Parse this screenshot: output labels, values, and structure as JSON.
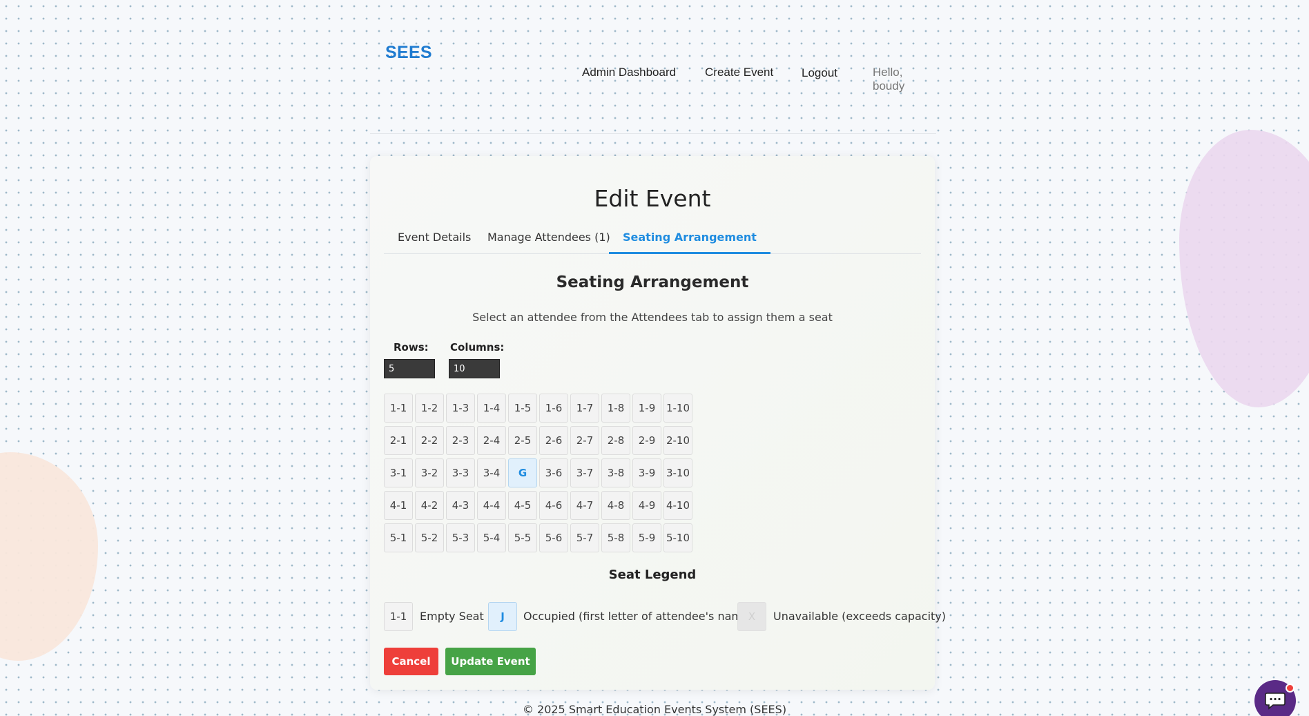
{
  "header": {
    "logo": "SEES",
    "nav": {
      "admin_dashboard": "Admin Dashboard",
      "create_event": "Create Event",
      "logout": "Logout"
    },
    "greeting": "Hello, boudy"
  },
  "card": {
    "title": "Edit Event",
    "tabs": {
      "details": "Event Details",
      "attendees": "Manage Attendees (1)",
      "seating": "Seating Arrangement"
    },
    "active_tab": "Seating Arrangement"
  },
  "seating": {
    "title": "Seating Arrangement",
    "instruction": "Select an attendee from the Attendees tab to assign them a seat",
    "rows_label": "Rows:",
    "rows_value": "5",
    "columns_label": "Columns:",
    "columns_value": "10",
    "grid": [
      [
        "1-1",
        "1-2",
        "1-3",
        "1-4",
        "1-5",
        "1-6",
        "1-7",
        "1-8",
        "1-9",
        "1-10"
      ],
      [
        "2-1",
        "2-2",
        "2-3",
        "2-4",
        "2-5",
        "2-6",
        "2-7",
        "2-8",
        "2-9",
        "2-10"
      ],
      [
        "3-1",
        "3-2",
        "3-3",
        "3-4",
        "G",
        "3-6",
        "3-7",
        "3-8",
        "3-9",
        "3-10"
      ],
      [
        "4-1",
        "4-2",
        "4-3",
        "4-4",
        "4-5",
        "4-6",
        "4-7",
        "4-8",
        "4-9",
        "4-10"
      ],
      [
        "5-1",
        "5-2",
        "5-3",
        "5-4",
        "5-5",
        "5-6",
        "5-7",
        "5-8",
        "5-9",
        "5-10"
      ]
    ],
    "occupied_seats": [
      "3-5"
    ]
  },
  "legend": {
    "title": "Seat Legend",
    "empty_sample": "1-1",
    "empty_label": "Empty Seat",
    "occupied_sample": "J",
    "occupied_label": "Occupied (first letter of attendee's name)",
    "unavailable_sample": "X",
    "unavailable_label": "Unavailable (exceeds capacity)"
  },
  "actions": {
    "cancel": "Cancel",
    "update": "Update Event"
  },
  "footer": "© 2025 Smart Education Events System (SEES)",
  "colors": {
    "brand": "#1f7bd0",
    "tab_active": "#1f8ce0",
    "cancel": "#ee3f3a",
    "update": "#46a346",
    "chat": "#5a2a86",
    "occupied_seat": "#e1f0fc"
  },
  "icons": {
    "chat": "chat-bubble-icon"
  }
}
